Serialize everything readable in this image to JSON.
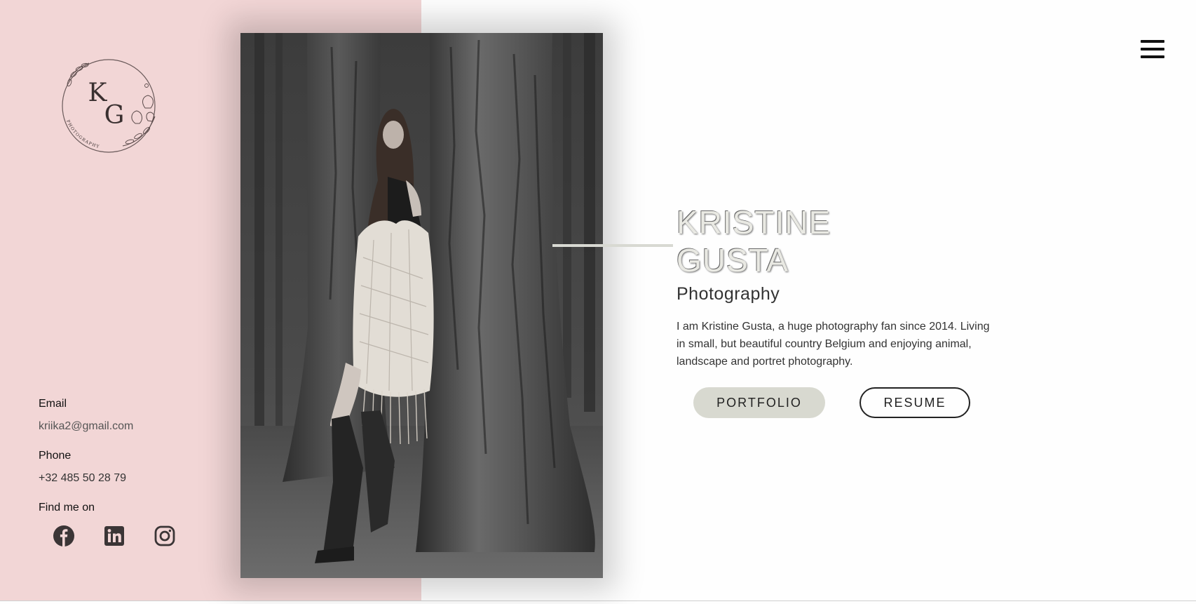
{
  "brand": {
    "monogram_k": "K",
    "monogram_g": "G",
    "monogram_text": "PHOTOGRAPHY"
  },
  "contact": {
    "email_label": "Email",
    "email_value": "kriika2@gmail.com",
    "phone_label": "Phone",
    "phone_value": "+32 485 50 28 79",
    "social_label": "Find me on"
  },
  "social": [
    {
      "icon": "facebook-icon"
    },
    {
      "icon": "linkedin-icon"
    },
    {
      "icon": "instagram-icon"
    }
  ],
  "hero": {
    "first_name": "KRISTINE",
    "last_name": "GUSTA",
    "subtitle": "Photography",
    "bio": "I am Kristine Gusta, a huge photography fan since 2014. Living in small, but beautiful country Belgium and enjoying animal, landscape and portret photography."
  },
  "buttons": {
    "portfolio": "PORTFOLIO",
    "resume": "RESUME"
  },
  "nav": {
    "menu_icon": "hamburger-menu-icon"
  },
  "colors": {
    "panel": "#f2d6d6",
    "accent": "#d8d9d0",
    "text": "#222222"
  }
}
